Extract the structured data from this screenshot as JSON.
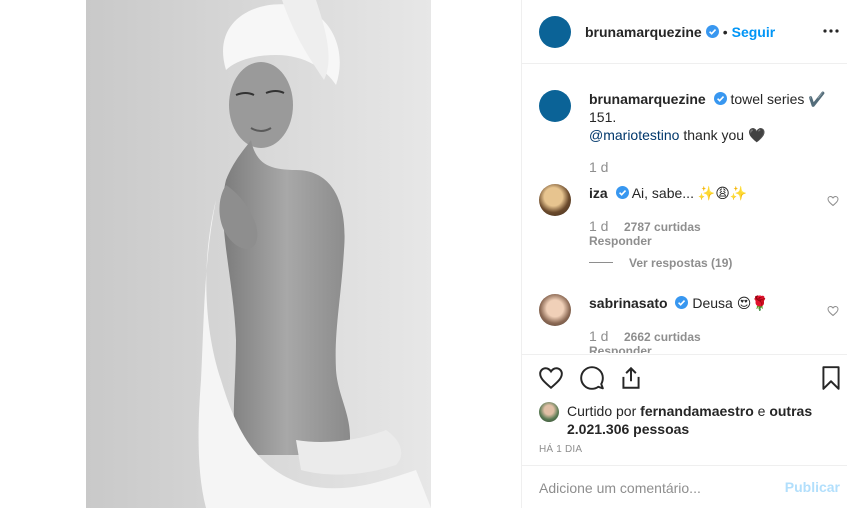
{
  "post": {
    "username": "brunamarquezine",
    "follow_label": "Seguir",
    "dot": "•",
    "caption": {
      "text_line1": "towel series ✔️",
      "text_line2": "151.",
      "mention": "@mariotestino",
      "text_after_mention": "thank you 🖤",
      "age": "1 d"
    },
    "comments": [
      {
        "username": "iza",
        "text": "Ai, sabe... ✨😩✨",
        "age": "1 d",
        "likes": "2787 curtidas",
        "reply_label": "Responder",
        "view_replies": "Ver respostas (19)"
      },
      {
        "username": "sabrinasato",
        "text": "Deusa 😍🌹",
        "age": "1 d",
        "likes": "2662 curtidas",
        "reply_label": "Responder"
      }
    ],
    "likes_summary": {
      "prefix": "Curtido por",
      "liker": "fernandamaestro",
      "suffix": "e",
      "others": "outras 2.021.306 pessoas"
    },
    "timestamp": "HÁ 1 DIA",
    "add_comment": {
      "placeholder": "Adicione um comentário...",
      "publish_label": "Publicar"
    }
  },
  "colors": {
    "accent": "#0095f6",
    "mention": "#00376b",
    "muted": "#8e8e8e",
    "publish_disabled": "#b2dffc",
    "avatar_blue": "#0b6397"
  },
  "icons": [
    "more-icon",
    "verified-icon",
    "heart-icon",
    "comment-icon",
    "share-icon",
    "bookmark-icon"
  ]
}
